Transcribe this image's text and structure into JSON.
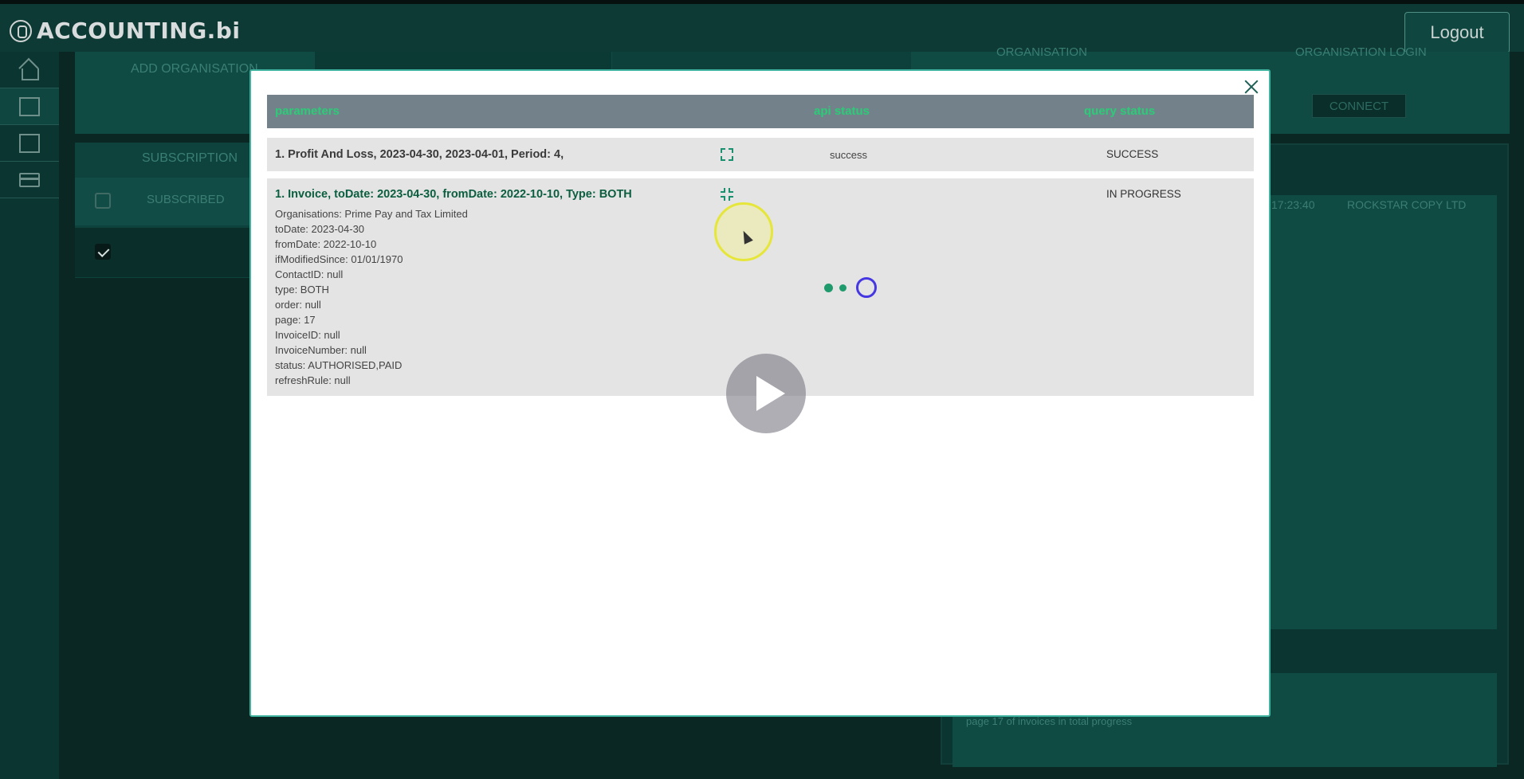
{
  "app": {
    "logo_text": "ACCOUNTING.bi",
    "logout_label": "Logout"
  },
  "sidebar": {
    "items": [
      {
        "icon": "home-icon"
      },
      {
        "icon": "building-icon"
      },
      {
        "icon": "newspaper-icon"
      },
      {
        "icon": "credit-card-icon"
      }
    ]
  },
  "background": {
    "add_org_label": "ADD ORGANISATION",
    "org_header": "ORGANISATION",
    "org_login_header": "ORGANISATION LOGIN",
    "connect_label": "CONNECT",
    "subscription_header": "SUBSCRIPTION",
    "subscribed_label": "SUBSCRIBED",
    "bg_row_time": "17:23:40",
    "bg_row_org": "ROCKSTAR COPY LTD",
    "bg_footer_text": "page 17 of invoices in total progress"
  },
  "modal": {
    "columns": {
      "parameters": "parameters",
      "api_status": "api status",
      "query_status": "query status"
    },
    "rows": [
      {
        "title": "1. Profit And Loss, 2023-04-30, 2023-04-01, Period: 4,",
        "api_status": "success",
        "query_status": "SUCCESS"
      },
      {
        "title": "1. Invoice, toDate: 2023-04-30, fromDate: 2022-10-10, Type: BOTH",
        "api_status": "",
        "query_status": "IN PROGRESS",
        "params": [
          "Organisations: Prime Pay and Tax Limited",
          "toDate: 2023-04-30",
          "fromDate: 2022-10-10",
          "ifModifiedSince: 01/01/1970",
          "ContactID: null",
          "type: BOTH",
          "order: null",
          "page: 17",
          "InvoiceID: null",
          "InvoiceNumber: null",
          "status: AUTHORISED,PAID",
          "refreshRule: null"
        ]
      }
    ]
  }
}
